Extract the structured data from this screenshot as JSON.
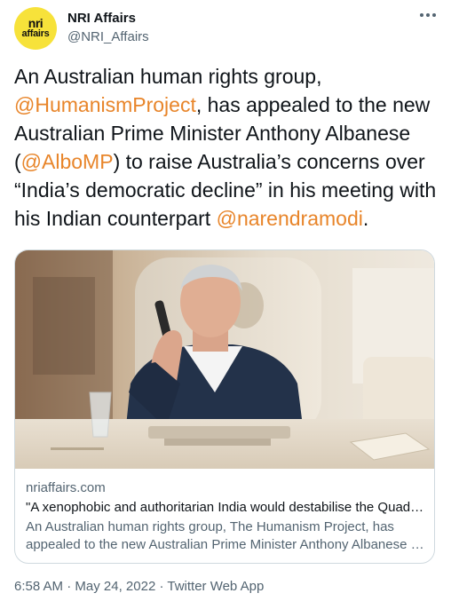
{
  "account": {
    "avatar_line1": "nri",
    "avatar_line2": "affairs",
    "display_name": "NRI Affairs",
    "handle": "@NRI_Affairs"
  },
  "tweet": {
    "text_1": "An Australian human rights group, ",
    "mention_1": "@HumanismProject",
    "text_2": ", has appealed to the new Australian Prime Minister Anthony Albanese (",
    "mention_2": "@AlboMP",
    "text_3": ")  to raise Australia’s concerns over “India’s democratic decline” in his meeting with his Indian counterpart ",
    "mention_3": "@narendramodi",
    "text_4": "."
  },
  "card": {
    "domain": "nriaffairs.com",
    "title": "\"A xenophobic and authoritarian India would destabilise the Quad\" Australian human rights group urges PM",
    "desc_line1": "An Australian human rights group, The Humanism Project, has",
    "desc_line2": "appealed to the new Australian Prime Minister Anthony Albanese to raise concerns"
  },
  "footer": {
    "time": "6:58 AM",
    "sep1": " · ",
    "date": "May 24, 2022",
    "sep2": " · ",
    "source": "Twitter Web App"
  },
  "colors": {
    "mention": "#e8852a",
    "secondary_text": "#536471",
    "avatar_bg": "#f7e23a"
  }
}
